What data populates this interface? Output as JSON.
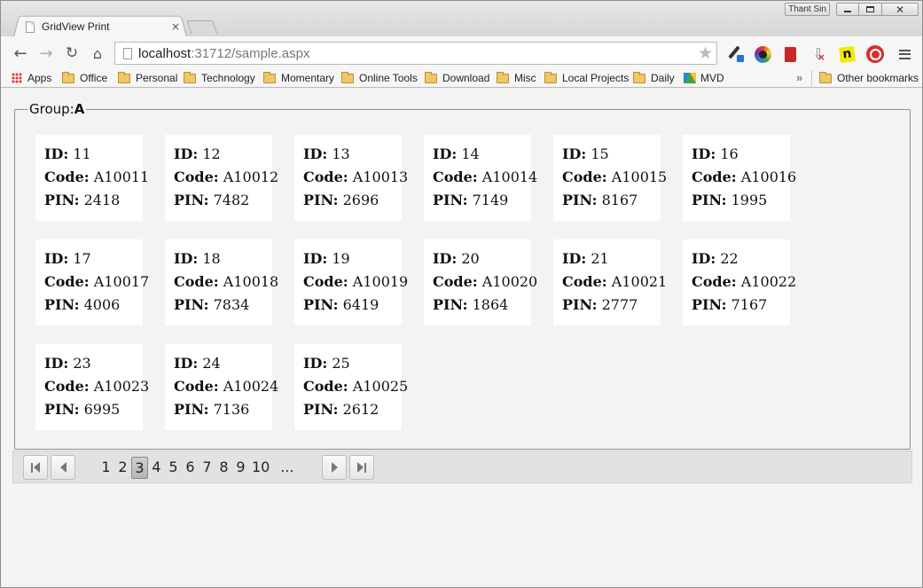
{
  "browser": {
    "tab_title": "GridView Print",
    "tab_close": "×",
    "user_name": "Thant Sin",
    "url_host": "localhost",
    "url_path": ":31712/sample.aspx",
    "bookmarks": [
      {
        "label": "Apps",
        "type": "apps"
      },
      {
        "label": "Office",
        "type": "folder"
      },
      {
        "label": "Personal",
        "type": "folder"
      },
      {
        "label": "Technology",
        "type": "folder"
      },
      {
        "label": "Momentary",
        "type": "folder"
      },
      {
        "label": "Online Tools",
        "type": "folder"
      },
      {
        "label": "Download",
        "type": "folder"
      },
      {
        "label": "Misc",
        "type": "folder"
      },
      {
        "label": "Local Projects",
        "type": "folder"
      },
      {
        "label": "Daily",
        "type": "folder"
      },
      {
        "label": "MVD",
        "type": "drive"
      }
    ],
    "overflow": "»",
    "other_bookmarks": "Other bookmarks"
  },
  "group": {
    "prefix": "Group:",
    "name": "A"
  },
  "labels": {
    "id": "ID:",
    "code": "Code:",
    "pin": "PIN:"
  },
  "records": [
    {
      "id": "11",
      "code": "A10011",
      "pin": "2418"
    },
    {
      "id": "12",
      "code": "A10012",
      "pin": "7482"
    },
    {
      "id": "13",
      "code": "A10013",
      "pin": "2696"
    },
    {
      "id": "14",
      "code": "A10014",
      "pin": "7149"
    },
    {
      "id": "15",
      "code": "A10015",
      "pin": "8167"
    },
    {
      "id": "16",
      "code": "A10016",
      "pin": "1995"
    },
    {
      "id": "17",
      "code": "A10017",
      "pin": "4006"
    },
    {
      "id": "18",
      "code": "A10018",
      "pin": "7834"
    },
    {
      "id": "19",
      "code": "A10019",
      "pin": "6419"
    },
    {
      "id": "20",
      "code": "A10020",
      "pin": "1864"
    },
    {
      "id": "21",
      "code": "A10021",
      "pin": "2777"
    },
    {
      "id": "22",
      "code": "A10022",
      "pin": "7167"
    },
    {
      "id": "23",
      "code": "A10023",
      "pin": "6995"
    },
    {
      "id": "24",
      "code": "A10024",
      "pin": "7136"
    },
    {
      "id": "25",
      "code": "A10025",
      "pin": "2612"
    }
  ],
  "pager": {
    "pages": [
      "1",
      "2",
      "3",
      "4",
      "5",
      "6",
      "7",
      "8",
      "9",
      "10",
      "..."
    ],
    "current_page": "3"
  }
}
